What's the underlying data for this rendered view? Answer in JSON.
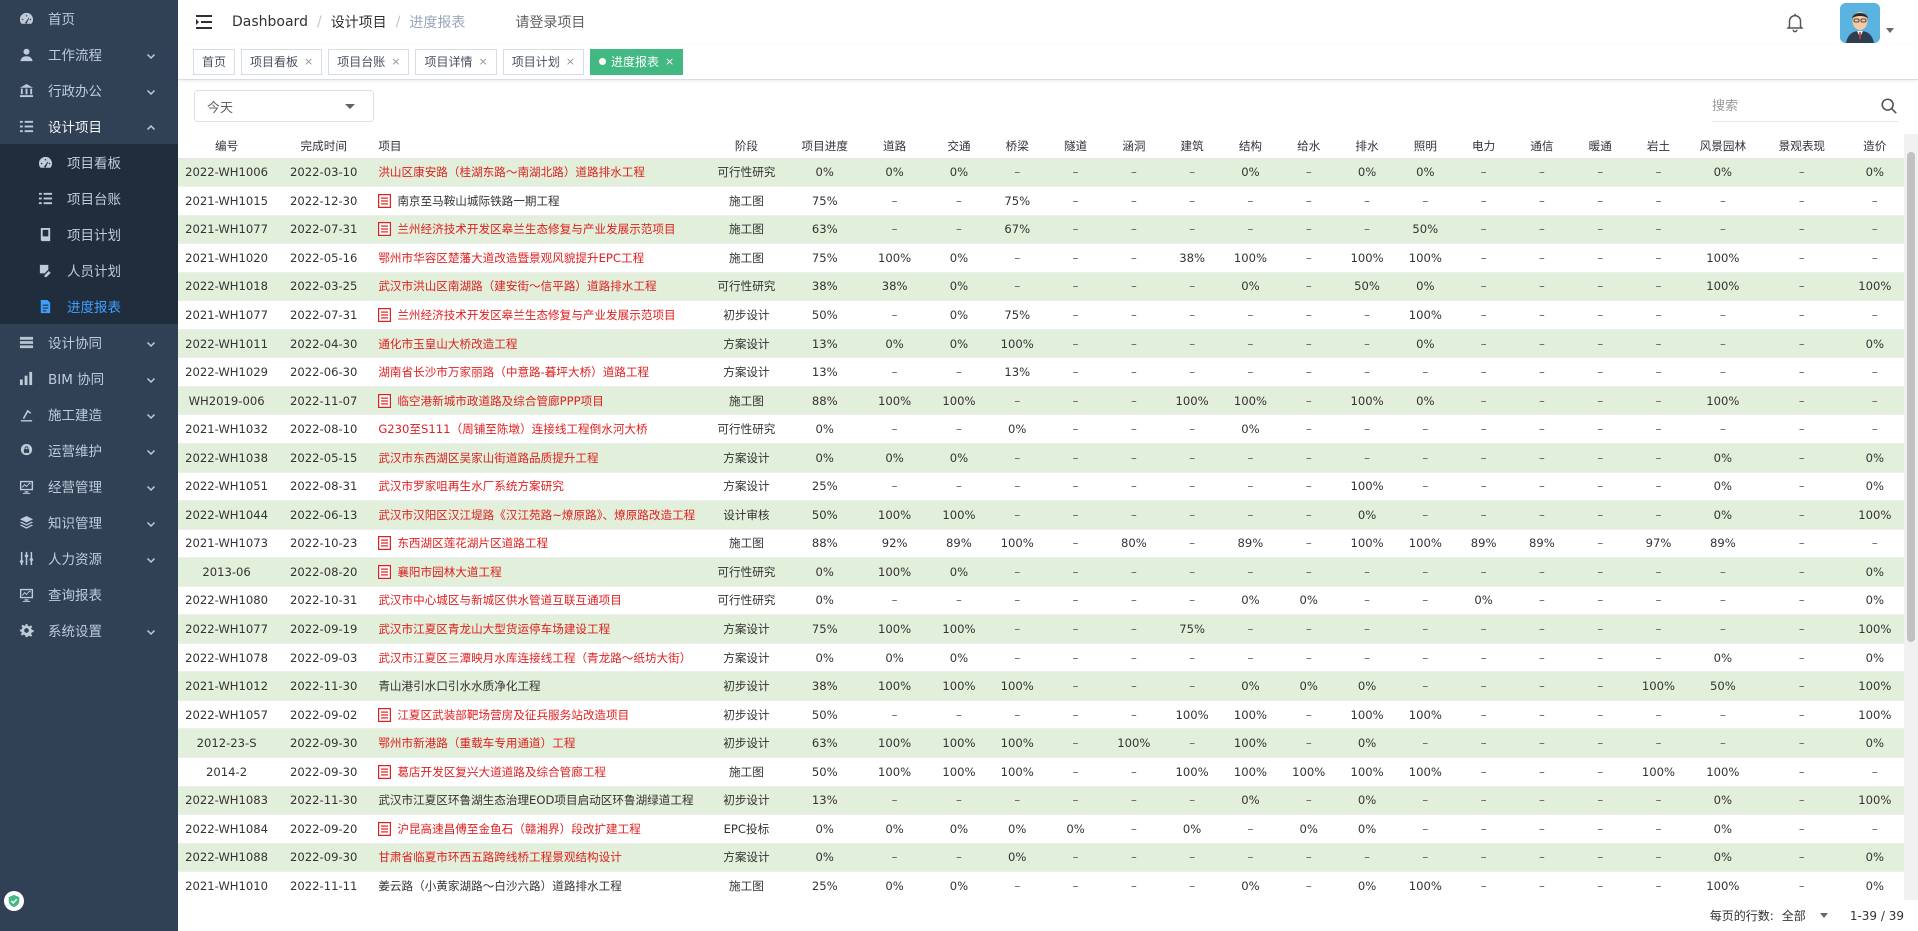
{
  "sidebar": {
    "items": [
      {
        "label": "首页",
        "icon": "dashboard-icon",
        "has_children": false
      },
      {
        "label": "工作流程",
        "icon": "user-icon",
        "has_children": true
      },
      {
        "label": "行政办公",
        "icon": "bank-icon",
        "has_children": true
      },
      {
        "label": "设计项目",
        "icon": "list-icon",
        "has_children": true,
        "open": true,
        "children": [
          {
            "label": "项目看板",
            "icon": "dashboard-icon"
          },
          {
            "label": "项目台账",
            "icon": "list-icon"
          },
          {
            "label": "项目计划",
            "icon": "book-icon"
          },
          {
            "label": "人员计划",
            "icon": "edit-icon"
          },
          {
            "label": "进度报表",
            "icon": "document-icon",
            "active": true
          }
        ]
      },
      {
        "label": "设计协同",
        "icon": "layers-icon",
        "has_children": true
      },
      {
        "label": "BIM 协同",
        "icon": "bar-chart-icon",
        "has_children": true
      },
      {
        "label": "施工建造",
        "icon": "build-icon",
        "has_children": true
      },
      {
        "label": "运营维护",
        "icon": "lock-icon",
        "has_children": true
      },
      {
        "label": "经营管理",
        "icon": "monitor-icon",
        "has_children": true
      },
      {
        "label": "知识管理",
        "icon": "stack-icon",
        "has_children": true
      },
      {
        "label": "人力资源",
        "icon": "sliders-icon",
        "has_children": true
      },
      {
        "label": "查询报表",
        "icon": "monitor-icon",
        "has_children": false
      },
      {
        "label": "系统设置",
        "icon": "gear-icon",
        "has_children": true
      }
    ]
  },
  "navbar": {
    "breadcrumb": [
      "Dashboard",
      "设计项目",
      "进度报表"
    ],
    "login_project": "请登录项目"
  },
  "tags": [
    {
      "label": "首页",
      "closable": false
    },
    {
      "label": "项目看板",
      "closable": true
    },
    {
      "label": "项目台账",
      "closable": true
    },
    {
      "label": "项目详情",
      "closable": true
    },
    {
      "label": "项目计划",
      "closable": true
    },
    {
      "label": "进度报表",
      "closable": true,
      "active": true
    }
  ],
  "toolbar": {
    "date_filter": "今天",
    "search_placeholder": "搜索"
  },
  "table": {
    "columns": [
      "编号",
      "完成时间",
      "项目",
      "阶段",
      "项目进度",
      "道路",
      "交通",
      "桥梁",
      "隧道",
      "涵洞",
      "建筑",
      "结构",
      "给水",
      "排水",
      "照明",
      "电力",
      "通信",
      "暖通",
      "岩土",
      "风景园林",
      "景观表现",
      "造价"
    ],
    "rows": [
      {
        "c": [
          "2022-WH1006",
          "2022-03-10",
          "洪山区康安路（桂湖东路～南湖北路）道路排水工程",
          "可行性研究",
          "0%",
          "0%",
          "0%",
          "–",
          "–",
          "–",
          "–",
          "0%",
          "–",
          "0%",
          "0%",
          "–",
          "–",
          "–",
          "–",
          "0%",
          "–",
          "0%"
        ],
        "red": true,
        "doc": false
      },
      {
        "c": [
          "2021-WH1015",
          "2022-12-30",
          "南京至马鞍山城际铁路一期工程",
          "施工图",
          "75%",
          "–",
          "–",
          "75%",
          "–",
          "–",
          "–",
          "–",
          "–",
          "–",
          "–",
          "–",
          "–",
          "–",
          "–",
          "–",
          "–",
          "–"
        ],
        "red": false,
        "doc": true
      },
      {
        "c": [
          "2021-WH1077",
          "2022-07-31",
          "兰州经济技术开发区皋兰生态修复与产业发展示范项目",
          "施工图",
          "63%",
          "–",
          "–",
          "67%",
          "–",
          "–",
          "–",
          "–",
          "–",
          "–",
          "50%",
          "–",
          "–",
          "–",
          "–",
          "–",
          "–",
          "–"
        ],
        "red": true,
        "doc": true
      },
      {
        "c": [
          "2021-WH1020",
          "2022-05-16",
          "鄂州市华容区楚藩大道改造暨景观风貌提升EPC工程",
          "施工图",
          "75%",
          "100%",
          "0%",
          "–",
          "–",
          "–",
          "38%",
          "100%",
          "–",
          "100%",
          "100%",
          "–",
          "–",
          "–",
          "–",
          "100%",
          "–",
          "–"
        ],
        "red": true,
        "doc": false
      },
      {
        "c": [
          "2022-WH1018",
          "2022-03-25",
          "武汉市洪山区南湖路（建安街～信平路）道路排水工程",
          "可行性研究",
          "38%",
          "38%",
          "0%",
          "–",
          "–",
          "–",
          "–",
          "0%",
          "–",
          "50%",
          "0%",
          "–",
          "–",
          "–",
          "–",
          "100%",
          "–",
          "100%"
        ],
        "red": true,
        "doc": false
      },
      {
        "c": [
          "2021-WH1077",
          "2022-07-31",
          "兰州经济技术开发区皋兰生态修复与产业发展示范项目",
          "初步设计",
          "50%",
          "–",
          "0%",
          "75%",
          "–",
          "–",
          "–",
          "–",
          "–",
          "–",
          "100%",
          "–",
          "–",
          "–",
          "–",
          "–",
          "–",
          "–"
        ],
        "red": true,
        "doc": true
      },
      {
        "c": [
          "2022-WH1011",
          "2022-04-30",
          "通化市玉皇山大桥改造工程",
          "方案设计",
          "13%",
          "0%",
          "0%",
          "100%",
          "–",
          "–",
          "–",
          "–",
          "–",
          "–",
          "0%",
          "–",
          "–",
          "–",
          "–",
          "–",
          "–",
          "0%"
        ],
        "red": true,
        "doc": false
      },
      {
        "c": [
          "2022-WH1029",
          "2022-06-30",
          "湖南省长沙市万家丽路（中意路-暮坪大桥）道路工程",
          "方案设计",
          "13%",
          "–",
          "–",
          "13%",
          "–",
          "–",
          "–",
          "–",
          "–",
          "–",
          "–",
          "–",
          "–",
          "–",
          "–",
          "–",
          "–",
          "–"
        ],
        "red": true,
        "doc": false
      },
      {
        "c": [
          "WH2019-006",
          "2022-11-07",
          "临空港新城市政道路及综合管廊PPP项目",
          "施工图",
          "88%",
          "100%",
          "100%",
          "–",
          "–",
          "–",
          "100%",
          "100%",
          "–",
          "100%",
          "0%",
          "–",
          "–",
          "–",
          "–",
          "100%",
          "–",
          "–"
        ],
        "red": true,
        "doc": true
      },
      {
        "c": [
          "2021-WH1032",
          "2022-08-10",
          "G230至S111（周铺至陈墩）连接线工程倒水河大桥",
          "可行性研究",
          "0%",
          "–",
          "–",
          "0%",
          "–",
          "–",
          "–",
          "0%",
          "–",
          "–",
          "–",
          "–",
          "–",
          "–",
          "–",
          "–",
          "–",
          "–"
        ],
        "red": true,
        "doc": false
      },
      {
        "c": [
          "2022-WH1038",
          "2022-05-15",
          "武汉市东西湖区吴家山街道路品质提升工程",
          "方案设计",
          "0%",
          "0%",
          "0%",
          "–",
          "–",
          "–",
          "–",
          "–",
          "–",
          "–",
          "–",
          "–",
          "–",
          "–",
          "–",
          "0%",
          "–",
          "0%"
        ],
        "red": true,
        "doc": false
      },
      {
        "c": [
          "2022-WH1051",
          "2022-08-31",
          "武汉市罗家咀再生水厂系统方案研究",
          "方案设计",
          "25%",
          "–",
          "–",
          "–",
          "–",
          "–",
          "–",
          "–",
          "–",
          "100%",
          "–",
          "–",
          "–",
          "–",
          "–",
          "0%",
          "–",
          "0%"
        ],
        "red": true,
        "doc": false
      },
      {
        "c": [
          "2022-WH1044",
          "2022-06-13",
          "武汉市汉阳区汉江堤路《汉江苑路~燎原路》、燎原路改造工程",
          "设计审核",
          "50%",
          "100%",
          "100%",
          "–",
          "–",
          "–",
          "–",
          "–",
          "–",
          "0%",
          "–",
          "–",
          "–",
          "–",
          "–",
          "0%",
          "–",
          "100%"
        ],
        "red": true,
        "doc": false
      },
      {
        "c": [
          "2021-WH1073",
          "2022-10-23",
          "东西湖区莲花湖片区道路工程",
          "施工图",
          "88%",
          "92%",
          "89%",
          "100%",
          "–",
          "80%",
          "–",
          "89%",
          "–",
          "100%",
          "100%",
          "89%",
          "89%",
          "–",
          "97%",
          "89%",
          "–",
          "–"
        ],
        "red": true,
        "doc": true
      },
      {
        "c": [
          "2013-06",
          "2022-08-20",
          "襄阳市园林大道工程",
          "可行性研究",
          "0%",
          "100%",
          "0%",
          "–",
          "–",
          "–",
          "–",
          "–",
          "–",
          "–",
          "–",
          "–",
          "–",
          "–",
          "–",
          "–",
          "–",
          "0%"
        ],
        "red": true,
        "doc": true
      },
      {
        "c": [
          "2022-WH1080",
          "2022-10-31",
          "武汉市中心城区与新城区供水管道互联互通项目",
          "可行性研究",
          "0%",
          "–",
          "–",
          "–",
          "–",
          "–",
          "–",
          "0%",
          "0%",
          "–",
          "–",
          "0%",
          "–",
          "–",
          "–",
          "–",
          "–",
          "0%"
        ],
        "red": true,
        "doc": false
      },
      {
        "c": [
          "2022-WH1077",
          "2022-09-19",
          "武汉市江夏区青龙山大型货运停车场建设工程",
          "方案设计",
          "75%",
          "100%",
          "100%",
          "–",
          "–",
          "–",
          "75%",
          "–",
          "–",
          "–",
          "–",
          "–",
          "–",
          "–",
          "–",
          "–",
          "–",
          "100%"
        ],
        "red": true,
        "doc": false
      },
      {
        "c": [
          "2022-WH1078",
          "2022-09-03",
          "武汉市江夏区三潭映月水库连接线工程（青龙路～纸坊大街）",
          "方案设计",
          "0%",
          "0%",
          "0%",
          "–",
          "–",
          "–",
          "–",
          "–",
          "–",
          "–",
          "–",
          "–",
          "–",
          "–",
          "–",
          "0%",
          "–",
          "0%"
        ],
        "red": true,
        "doc": false
      },
      {
        "c": [
          "2021-WH1012",
          "2022-11-30",
          "青山港引水口引水水质净化工程",
          "初步设计",
          "38%",
          "100%",
          "100%",
          "100%",
          "–",
          "–",
          "–",
          "0%",
          "0%",
          "0%",
          "–",
          "–",
          "–",
          "–",
          "100%",
          "50%",
          "–",
          "100%"
        ],
        "red": false,
        "doc": false
      },
      {
        "c": [
          "2022-WH1057",
          "2022-09-02",
          "江夏区武装部靶场营房及征兵服务站改造项目",
          "初步设计",
          "50%",
          "–",
          "–",
          "–",
          "–",
          "–",
          "100%",
          "100%",
          "–",
          "100%",
          "100%",
          "–",
          "–",
          "–",
          "–",
          "–",
          "–",
          "100%"
        ],
        "red": true,
        "doc": true
      },
      {
        "c": [
          "2012-23-S",
          "2022-09-30",
          "鄂州市新港路（重载车专用通道）工程",
          "初步设计",
          "63%",
          "100%",
          "100%",
          "100%",
          "–",
          "100%",
          "–",
          "100%",
          "–",
          "0%",
          "–",
          "–",
          "–",
          "–",
          "–",
          "–",
          "–",
          "0%"
        ],
        "red": true,
        "doc": false
      },
      {
        "c": [
          "2014-2",
          "2022-09-30",
          "葛店开发区复兴大道道路及综合管廊工程",
          "施工图",
          "50%",
          "100%",
          "100%",
          "100%",
          "–",
          "–",
          "100%",
          "100%",
          "100%",
          "100%",
          "100%",
          "–",
          "–",
          "–",
          "100%",
          "100%",
          "–",
          "–"
        ],
        "red": true,
        "doc": true
      },
      {
        "c": [
          "2022-WH1083",
          "2022-11-30",
          "武汉市江夏区环鲁湖生态治理EOD项目启动区环鲁湖绿道工程",
          "初步设计",
          "13%",
          "–",
          "–",
          "–",
          "–",
          "–",
          "–",
          "0%",
          "–",
          "0%",
          "–",
          "–",
          "–",
          "–",
          "–",
          "0%",
          "–",
          "100%"
        ],
        "red": false,
        "doc": false
      },
      {
        "c": [
          "2022-WH1084",
          "2022-09-20",
          "沪昆高速昌傅至金鱼石（赣湘界）段改扩建工程",
          "EPC投标",
          "0%",
          "0%",
          "0%",
          "0%",
          "0%",
          "–",
          "0%",
          "–",
          "0%",
          "0%",
          "–",
          "–",
          "–",
          "–",
          "–",
          "0%",
          "–",
          "–"
        ],
        "red": true,
        "doc": true
      },
      {
        "c": [
          "2022-WH1088",
          "2022-09-30",
          "甘肃省临夏市环西五路跨线桥工程景观结构设计",
          "方案设计",
          "0%",
          "–",
          "–",
          "0%",
          "–",
          "–",
          "–",
          "–",
          "–",
          "–",
          "–",
          "–",
          "–",
          "–",
          "–",
          "0%",
          "–",
          "0%"
        ],
        "red": true,
        "doc": false
      },
      {
        "c": [
          "2021-WH1010",
          "2022-11-11",
          "姜云路（小黄家湖路～白沙六路）道路排水工程",
          "施工图",
          "25%",
          "0%",
          "0%",
          "–",
          "–",
          "–",
          "–",
          "0%",
          "–",
          "0%",
          "100%",
          "–",
          "–",
          "–",
          "–",
          "100%",
          "–",
          "0%"
        ],
        "red": false,
        "doc": false
      }
    ]
  },
  "footer": {
    "rows_per_page_label": "每页的行数:",
    "rows_per_page_value": "全部",
    "range": "1-39 / 39"
  },
  "colors": {
    "sidebar_bg": "#304156",
    "submenu_bg": "#1f2d3d",
    "active_link": "#409eff",
    "active_tag": "#42b983",
    "stripe_row": "#e2efda",
    "project_red": "#e02020"
  }
}
